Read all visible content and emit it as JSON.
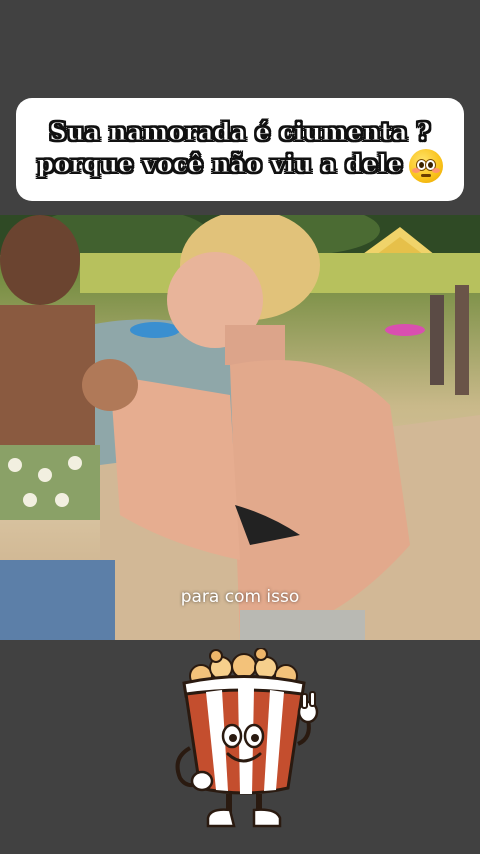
{
  "caption": {
    "line1": "Sua namorada é ciumenta ?",
    "line2": "porque você não viu a dele"
  },
  "icons": {
    "caption_emoji": "flushed-face-emoji",
    "sticker": "popcorn-bucket-mascot"
  },
  "subtitle": "para com isso",
  "colors": {
    "background": "#414141",
    "caption_card": "#ffffff",
    "caption_text": "#ffffff",
    "caption_outline": "#111111"
  }
}
